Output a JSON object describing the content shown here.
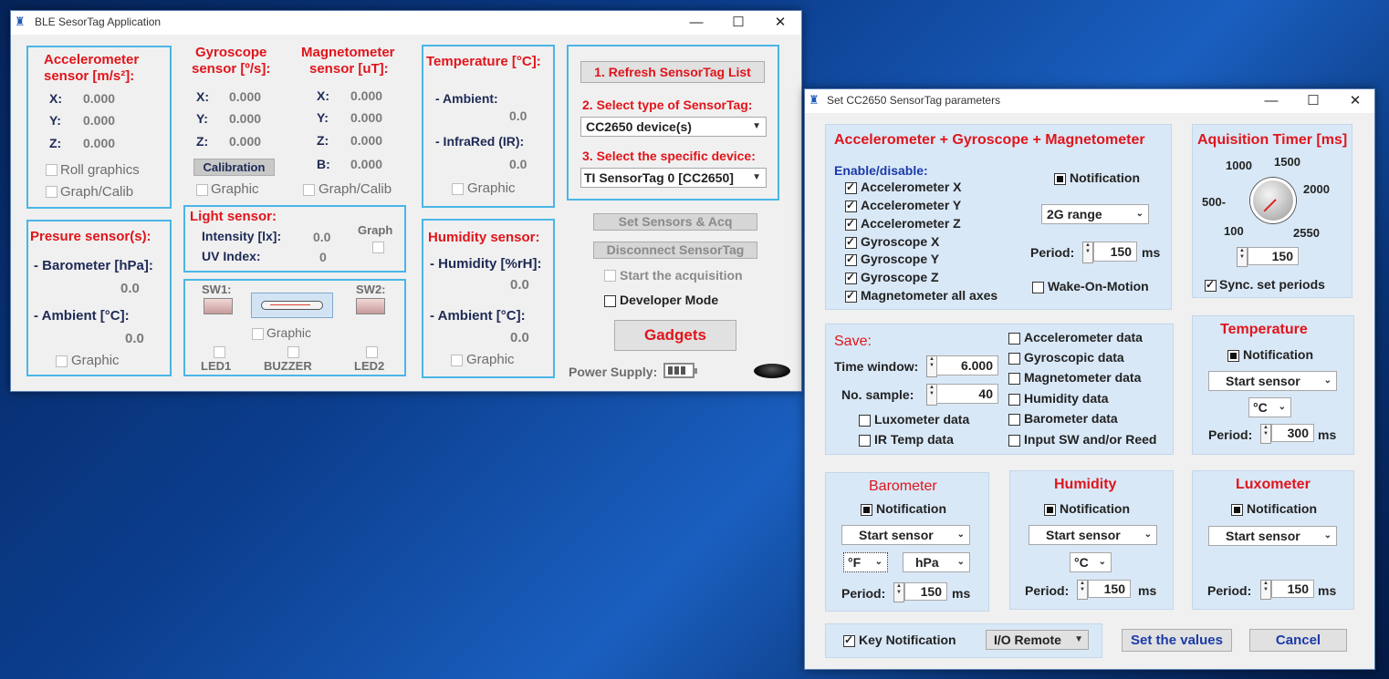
{
  "main": {
    "title": "BLE SesorTag Application",
    "accel": {
      "title1": "Accelerometer",
      "title2": "sensor [m/s²]:",
      "x": "X:",
      "y": "Y:",
      "z": "Z:",
      "xv": "0.000",
      "yv": "0.000",
      "zv": "0.000",
      "roll": "Roll graphics",
      "graph": "Graph/Calib"
    },
    "gyro": {
      "title1": "Gyroscope",
      "title2": "sensor [º/s]:",
      "x": "X:",
      "y": "Y:",
      "z": "Z:",
      "xv": "0.000",
      "yv": "0.000",
      "zv": "0.000",
      "calib": "Calibration",
      "graphic": "Graphic"
    },
    "magneto": {
      "title1": "Magnetometer",
      "title2": "sensor [uT]:",
      "x": "X:",
      "y": "Y:",
      "z": "Z:",
      "b": "B:",
      "xv": "0.000",
      "yv": "0.000",
      "zv": "0.000",
      "bv": "0.000",
      "graph": "Graph/Calib"
    },
    "temp": {
      "title": "Temperature [°C]:",
      "ambient": "- Ambient:",
      "ambient_v": "0.0",
      "ir": "- InfraRed (IR):",
      "ir_v": "0.0",
      "graphic": "Graphic"
    },
    "pressure": {
      "title": "Presure sensor(s):",
      "barometer": "- Barometer  [hPa]:",
      "baro_v": "0.0",
      "ambient": "- Ambient [°C]:",
      "ambient_v": "0.0",
      "graphic": "Graphic"
    },
    "light": {
      "title": "Light sensor:",
      "intensity": "Intensity [lx]:",
      "intensity_v": "0.0",
      "uv": "UV Index:",
      "uv_v": "0",
      "graph": "Graph"
    },
    "humidity": {
      "title": "Humidity sensor:",
      "hum": "- Humidity [%rH]:",
      "hum_v": "0.0",
      "ambient": "- Ambient [°C]:",
      "ambient_v": "0.0",
      "graphic": "Graphic"
    },
    "io": {
      "sw1": "SW1:",
      "sw2": "SW2:",
      "graphic": "Graphic",
      "led1": "LED1",
      "buzzer": "BUZZER",
      "led2": "LED2"
    },
    "steps": {
      "refresh": "1. Refresh SensorTag List",
      "select_type": "2. Select type of SensorTag:",
      "type_value": "CC2650 device(s)",
      "select_dev": "3. Select the specific device:",
      "dev_value": "TI SensorTag 0 [CC2650]"
    },
    "set_sensors": "Set Sensors & Acq",
    "disconnect": "Disconnect SensorTag",
    "start_acq": "Start the acquisition",
    "dev_mode": "Developer Mode",
    "gadgets": "Gadgets",
    "power": "Power Supply:"
  },
  "dialog": {
    "title": "Set CC2650 SensorTag parameters",
    "agm": {
      "title": "Accelerometer + Gyroscope + Magnetometer",
      "enable": "Enable/disable:",
      "items": [
        "Accelerometer X",
        "Accelerometer Y",
        "Accelerometer Z",
        "Gyroscope X",
        "Gyroscope Y",
        "Gyroscope Z",
        "Magnetometer all axes"
      ],
      "notification": "Notification",
      "range": "2G range",
      "period_lbl": "Period:",
      "period": "150",
      "ms": "ms",
      "wake": "Wake-On-Motion"
    },
    "timer": {
      "title": "Aquisition Timer [ms]",
      "t1000": "1000",
      "t1500": "1500",
      "t500": "500-",
      "t2000": "2000",
      "t100": "100",
      "t2550": "2550",
      "value": "150",
      "sync": "Sync. set periods"
    },
    "save": {
      "title": "Save:",
      "tw_lbl": "Time window:",
      "tw": "6.000",
      "ns_lbl": "No. sample:",
      "ns": "40",
      "lux": "Luxometer data",
      "irt": "IR Temp data",
      "items": [
        "Accelerometer data",
        "Gyroscopic data",
        "Magnetometer data",
        "Humidity data",
        "Barometer data",
        "Input SW and/or Reed"
      ]
    },
    "temperature": {
      "title": "Temperature",
      "notification": "Notification",
      "start": "Start sensor",
      "unit": "°C",
      "period_lbl": "Period:",
      "period": "300",
      "ms": "ms"
    },
    "barometer": {
      "title": "Barometer",
      "notification": "Notification",
      "start": "Start sensor",
      "unit1": "°F",
      "unit2": "hPa",
      "period_lbl": "Period:",
      "period": "150",
      "ms": "ms"
    },
    "humidity": {
      "title": "Humidity",
      "notification": "Notification",
      "start": "Start sensor",
      "unit": "°C",
      "period_lbl": "Period:",
      "period": "150",
      "ms": "ms"
    },
    "luxometer": {
      "title": "Luxometer",
      "notification": "Notification",
      "start": "Start sensor",
      "period_lbl": "Period:",
      "period": "150",
      "ms": "ms"
    },
    "key_notification": "Key Notification",
    "io_remote": "I/O Remote",
    "set_values": "Set the values",
    "cancel": "Cancel"
  }
}
